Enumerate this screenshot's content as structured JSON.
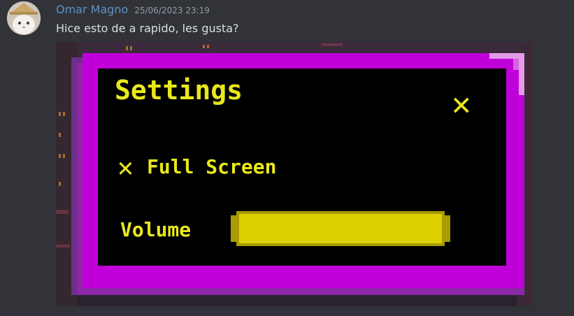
{
  "message": {
    "author": "Omar Magno",
    "timestamp": "25/06/2023 23:19",
    "text": "Hice esto de a rapido, les gusta?"
  },
  "attachment": {
    "settings_title": "Settings",
    "close_glyph": "✕",
    "fullscreen_glyph": "✕",
    "fullscreen_label": "Full Screen",
    "volume_label": "Volume",
    "volume_level": 1.0,
    "colors": {
      "frame": "#c000d8",
      "frame_dark": "#6e2f8c",
      "panel": "#000000",
      "text": "#e9e81b",
      "slider": "#dcd000"
    }
  }
}
